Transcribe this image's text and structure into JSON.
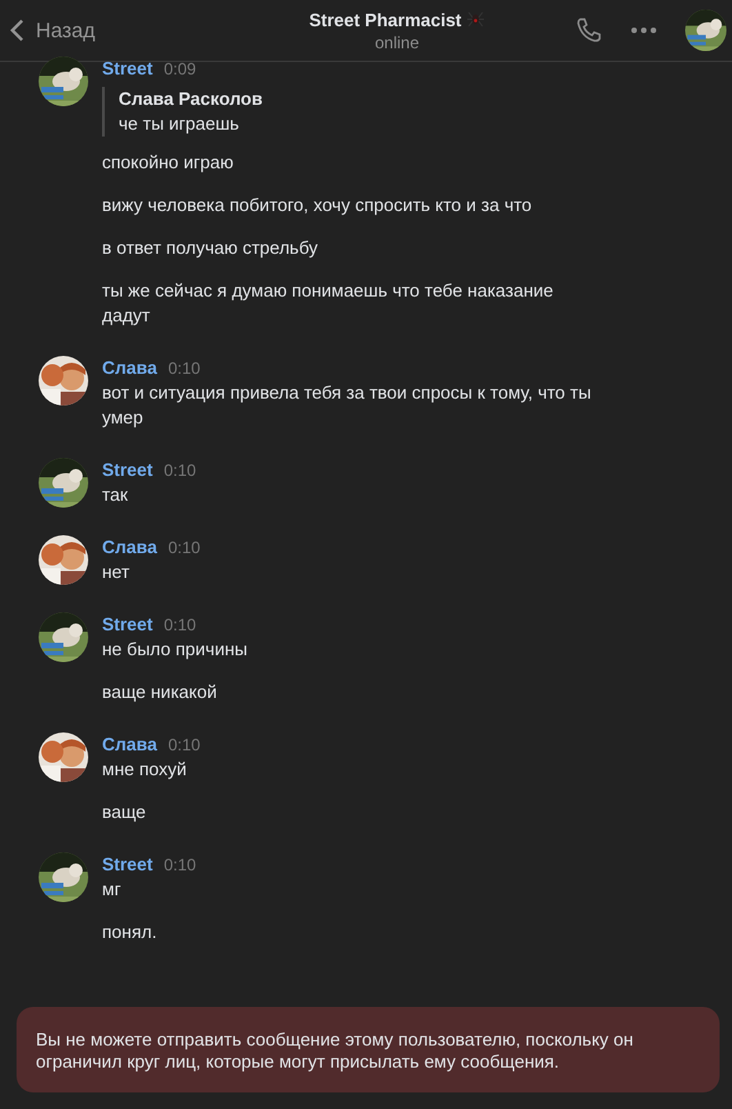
{
  "header": {
    "back": "Назад",
    "title": "Street Pharmacist",
    "status": "online"
  },
  "messages": [
    {
      "author": "Street",
      "time": "0:09",
      "items": [
        {
          "quote": {
            "author": "Слава Расколов",
            "text": "че ты играешь"
          }
        },
        {
          "text": "спокойно играю"
        },
        {
          "text": "вижу человека побитого, хочу спросить кто и за что"
        },
        {
          "text": "в ответ получаю стрельбу"
        },
        {
          "text": "ты же сейчас я думаю понимаешь что тебе наказание дадут"
        }
      ]
    },
    {
      "author": "Слава",
      "time": "0:10",
      "items": [
        {
          "text": "вот и ситуация привела тебя за твои спросы к тому, что ты умер"
        }
      ]
    },
    {
      "author": "Street",
      "time": "0:10",
      "items": [
        {
          "text": "так"
        }
      ]
    },
    {
      "author": "Слава",
      "time": "0:10",
      "items": [
        {
          "text": "нет"
        }
      ]
    },
    {
      "author": "Street",
      "time": "0:10",
      "items": [
        {
          "text": "не было причины"
        },
        {
          "text": "ваще никакой"
        }
      ]
    },
    {
      "author": "Слава",
      "time": "0:10",
      "items": [
        {
          "text": "мне похуй"
        },
        {
          "text": "ваще"
        }
      ]
    },
    {
      "author": "Street",
      "time": "0:10",
      "items": [
        {
          "text": "мг"
        },
        {
          "text": "понял."
        }
      ]
    }
  ],
  "notice": "Вы не можете отправить сообщение этому пользователю, поскольку он ограничил круг лиц, которые могут присылать ему сообщения."
}
